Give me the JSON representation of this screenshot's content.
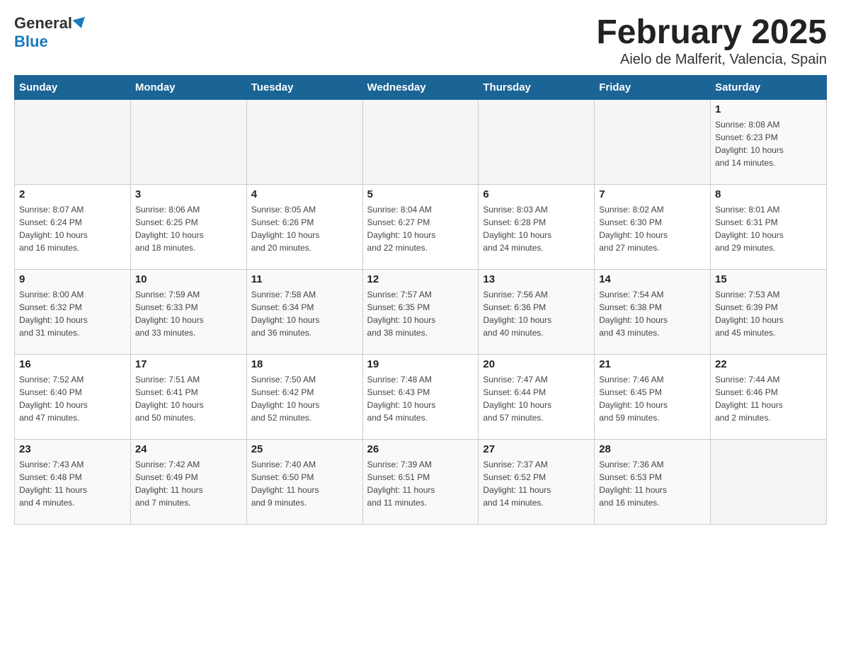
{
  "logo": {
    "general": "General",
    "blue": "Blue"
  },
  "title": "February 2025",
  "subtitle": "Aielo de Malferit, Valencia, Spain",
  "days_of_week": [
    "Sunday",
    "Monday",
    "Tuesday",
    "Wednesday",
    "Thursday",
    "Friday",
    "Saturday"
  ],
  "weeks": [
    [
      {
        "day": "",
        "info": ""
      },
      {
        "day": "",
        "info": ""
      },
      {
        "day": "",
        "info": ""
      },
      {
        "day": "",
        "info": ""
      },
      {
        "day": "",
        "info": ""
      },
      {
        "day": "",
        "info": ""
      },
      {
        "day": "1",
        "info": "Sunrise: 8:08 AM\nSunset: 6:23 PM\nDaylight: 10 hours\nand 14 minutes."
      }
    ],
    [
      {
        "day": "2",
        "info": "Sunrise: 8:07 AM\nSunset: 6:24 PM\nDaylight: 10 hours\nand 16 minutes."
      },
      {
        "day": "3",
        "info": "Sunrise: 8:06 AM\nSunset: 6:25 PM\nDaylight: 10 hours\nand 18 minutes."
      },
      {
        "day": "4",
        "info": "Sunrise: 8:05 AM\nSunset: 6:26 PM\nDaylight: 10 hours\nand 20 minutes."
      },
      {
        "day": "5",
        "info": "Sunrise: 8:04 AM\nSunset: 6:27 PM\nDaylight: 10 hours\nand 22 minutes."
      },
      {
        "day": "6",
        "info": "Sunrise: 8:03 AM\nSunset: 6:28 PM\nDaylight: 10 hours\nand 24 minutes."
      },
      {
        "day": "7",
        "info": "Sunrise: 8:02 AM\nSunset: 6:30 PM\nDaylight: 10 hours\nand 27 minutes."
      },
      {
        "day": "8",
        "info": "Sunrise: 8:01 AM\nSunset: 6:31 PM\nDaylight: 10 hours\nand 29 minutes."
      }
    ],
    [
      {
        "day": "9",
        "info": "Sunrise: 8:00 AM\nSunset: 6:32 PM\nDaylight: 10 hours\nand 31 minutes."
      },
      {
        "day": "10",
        "info": "Sunrise: 7:59 AM\nSunset: 6:33 PM\nDaylight: 10 hours\nand 33 minutes."
      },
      {
        "day": "11",
        "info": "Sunrise: 7:58 AM\nSunset: 6:34 PM\nDaylight: 10 hours\nand 36 minutes."
      },
      {
        "day": "12",
        "info": "Sunrise: 7:57 AM\nSunset: 6:35 PM\nDaylight: 10 hours\nand 38 minutes."
      },
      {
        "day": "13",
        "info": "Sunrise: 7:56 AM\nSunset: 6:36 PM\nDaylight: 10 hours\nand 40 minutes."
      },
      {
        "day": "14",
        "info": "Sunrise: 7:54 AM\nSunset: 6:38 PM\nDaylight: 10 hours\nand 43 minutes."
      },
      {
        "day": "15",
        "info": "Sunrise: 7:53 AM\nSunset: 6:39 PM\nDaylight: 10 hours\nand 45 minutes."
      }
    ],
    [
      {
        "day": "16",
        "info": "Sunrise: 7:52 AM\nSunset: 6:40 PM\nDaylight: 10 hours\nand 47 minutes."
      },
      {
        "day": "17",
        "info": "Sunrise: 7:51 AM\nSunset: 6:41 PM\nDaylight: 10 hours\nand 50 minutes."
      },
      {
        "day": "18",
        "info": "Sunrise: 7:50 AM\nSunset: 6:42 PM\nDaylight: 10 hours\nand 52 minutes."
      },
      {
        "day": "19",
        "info": "Sunrise: 7:48 AM\nSunset: 6:43 PM\nDaylight: 10 hours\nand 54 minutes."
      },
      {
        "day": "20",
        "info": "Sunrise: 7:47 AM\nSunset: 6:44 PM\nDaylight: 10 hours\nand 57 minutes."
      },
      {
        "day": "21",
        "info": "Sunrise: 7:46 AM\nSunset: 6:45 PM\nDaylight: 10 hours\nand 59 minutes."
      },
      {
        "day": "22",
        "info": "Sunrise: 7:44 AM\nSunset: 6:46 PM\nDaylight: 11 hours\nand 2 minutes."
      }
    ],
    [
      {
        "day": "23",
        "info": "Sunrise: 7:43 AM\nSunset: 6:48 PM\nDaylight: 11 hours\nand 4 minutes."
      },
      {
        "day": "24",
        "info": "Sunrise: 7:42 AM\nSunset: 6:49 PM\nDaylight: 11 hours\nand 7 minutes."
      },
      {
        "day": "25",
        "info": "Sunrise: 7:40 AM\nSunset: 6:50 PM\nDaylight: 11 hours\nand 9 minutes."
      },
      {
        "day": "26",
        "info": "Sunrise: 7:39 AM\nSunset: 6:51 PM\nDaylight: 11 hours\nand 11 minutes."
      },
      {
        "day": "27",
        "info": "Sunrise: 7:37 AM\nSunset: 6:52 PM\nDaylight: 11 hours\nand 14 minutes."
      },
      {
        "day": "28",
        "info": "Sunrise: 7:36 AM\nSunset: 6:53 PM\nDaylight: 11 hours\nand 16 minutes."
      },
      {
        "day": "",
        "info": ""
      }
    ]
  ]
}
